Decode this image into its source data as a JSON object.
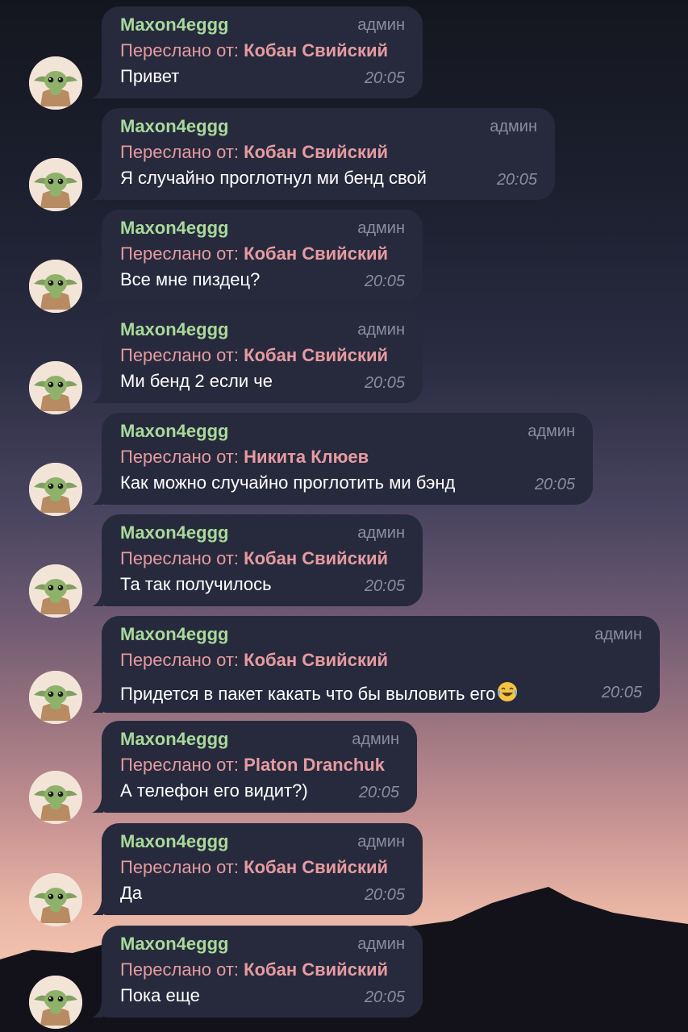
{
  "colors": {
    "bubble": "#272a3d",
    "sender": "#a8d99a",
    "forwarded": "#e69ba0",
    "meta": "#8a8da0"
  },
  "forwarded_prefix": "Переслано от:",
  "messages": [
    {
      "sender": "Maxon4eggg",
      "role": "админ",
      "forwarded_from": "Кобан Свийский",
      "text": "Привет",
      "time": "20:05"
    },
    {
      "sender": "Maxon4eggg",
      "role": "админ",
      "forwarded_from": "Кобан Свийский",
      "text": "Я случайно проглотнул ми бенд свой",
      "time": "20:05"
    },
    {
      "sender": "Maxon4eggg",
      "role": "админ",
      "forwarded_from": "Кобан Свийский",
      "text": "Все мне пиздец?",
      "time": "20:05"
    },
    {
      "sender": "Maxon4eggg",
      "role": "админ",
      "forwarded_from": "Кобан Свийский",
      "text": "Ми бенд 2 если че",
      "time": "20:05"
    },
    {
      "sender": "Maxon4eggg",
      "role": "админ",
      "forwarded_from": "Никита Клюев",
      "text": "Как можно случайно проглотить ми бэнд",
      "time": "20:05"
    },
    {
      "sender": "Maxon4eggg",
      "role": "админ",
      "forwarded_from": "Кобан Свийский",
      "text": "Та так получилось",
      "time": "20:05"
    },
    {
      "sender": "Maxon4eggg",
      "role": "админ",
      "forwarded_from": "Кобан Свийский",
      "text": "Придется в пакет какать что бы выловить его",
      "emoji": "face-with-tears-of-joy",
      "time": "20:05"
    },
    {
      "sender": "Maxon4eggg",
      "role": "админ",
      "forwarded_from": "Platon Dranchuk",
      "text": "А телефон его видит?)",
      "time": "20:05"
    },
    {
      "sender": "Maxon4eggg",
      "role": "админ",
      "forwarded_from": "Кобан Свийский",
      "text": "Да",
      "time": "20:05"
    },
    {
      "sender": "Maxon4eggg",
      "role": "админ",
      "forwarded_from": "Кобан Свийский",
      "text": "Пока еще",
      "time": "20:05"
    }
  ],
  "avatar_icon": "baby-yoda-avatar-icon"
}
